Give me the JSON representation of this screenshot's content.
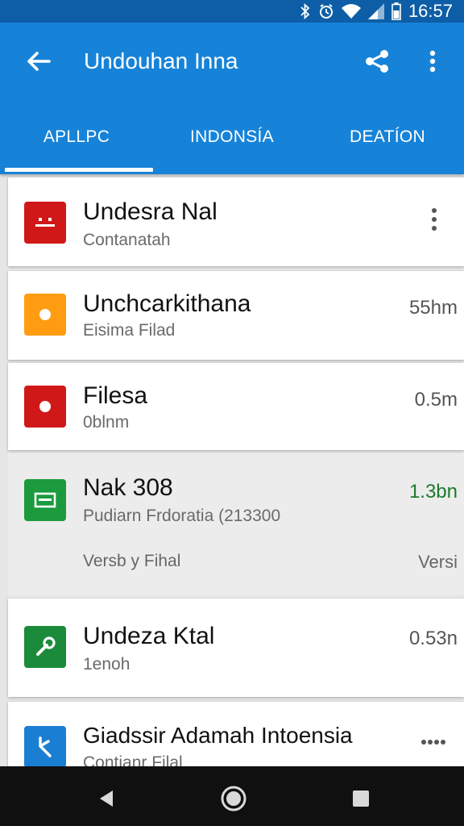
{
  "status_bar": {
    "time": "16:57",
    "icons": [
      "bluetooth-icon",
      "alarm-icon",
      "wifi-icon",
      "signal-icon",
      "battery-icon"
    ]
  },
  "app_bar": {
    "title": "Undouhan Inna"
  },
  "tabs": [
    {
      "label": "APLLPC",
      "selected": true
    },
    {
      "label": "INDONSÍA",
      "selected": false
    },
    {
      "label": "DEATÍON",
      "selected": false
    }
  ],
  "items": [
    {
      "title": "Undesra Nal",
      "subtitle": "Contanatah",
      "icon_color": "#d01818",
      "icon": "minus-face-icon",
      "trailing": "menu"
    },
    {
      "title": "Unchcarkithana",
      "subtitle": "Eisima Filad",
      "size": "55hm",
      "icon_color": "#ff9c12",
      "icon": "dot-icon"
    },
    {
      "title": "Filesa",
      "subtitle": "0blnm",
      "size": "0.5m",
      "icon_color": "#d01818",
      "icon": "dot-icon"
    },
    {
      "title": "Nak 308",
      "subtitle": "Pudiarn Frdoratia (213300",
      "size": "1.3bn",
      "size_color": "#1d7a2b",
      "icon_color": "#1b9a3e",
      "icon": "card-icon",
      "footer_left": "Versb y Fihal",
      "footer_right": "Versi"
    },
    {
      "title": "Undeza Ktal",
      "subtitle": "1enoh",
      "size": "0.53n",
      "icon_color": "#1b8a3a",
      "icon": "wrench-icon"
    },
    {
      "title": "Giadssir Adamah Intoensia",
      "subtitle": "Contianr Filal",
      "icon_color": "#1a7fd2",
      "icon": "share-icon",
      "trailing": "more-horizontal"
    }
  ],
  "colors": {
    "primary": "#1683d8",
    "status": "#0d5ea6",
    "nav": "#101010"
  }
}
